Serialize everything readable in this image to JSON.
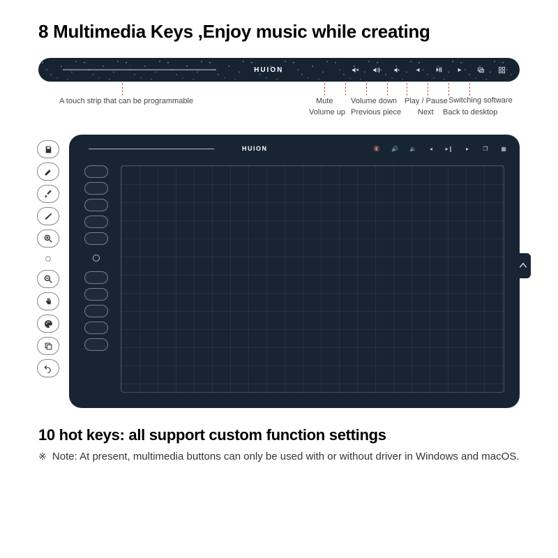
{
  "heading_top": "8 Multimedia Keys ,Enjoy music while creating",
  "brand": "HUION",
  "touch_strip_label": "A touch strip that can be programmable",
  "media_keys": [
    {
      "id": "mute",
      "label": "Mute",
      "row": 1
    },
    {
      "id": "volume-up",
      "label": "Volume up",
      "row": 2
    },
    {
      "id": "volume-down",
      "label": "Volume down",
      "row": 1
    },
    {
      "id": "previous-piece",
      "label": "Previous piece",
      "row": 2
    },
    {
      "id": "play-pause",
      "label": "Play / Pause",
      "row": 1
    },
    {
      "id": "next",
      "label": "Next",
      "row": 2
    },
    {
      "id": "switching-software",
      "label": "Switching software",
      "row": 1
    },
    {
      "id": "back-to-desktop",
      "label": "Back to desktop",
      "row": 2
    }
  ],
  "side_icons": [
    "save",
    "pencil",
    "brush",
    "pen",
    "zoom-in",
    "zoom-out",
    "hand",
    "palette",
    "copy",
    "undo"
  ],
  "heading_bottom": "10 hot keys: all support custom function settings",
  "note_prefix": "※",
  "note_label": "Note:",
  "note_body": "At present, multimedia buttons can only be used with or without driver in Windows and macOS."
}
